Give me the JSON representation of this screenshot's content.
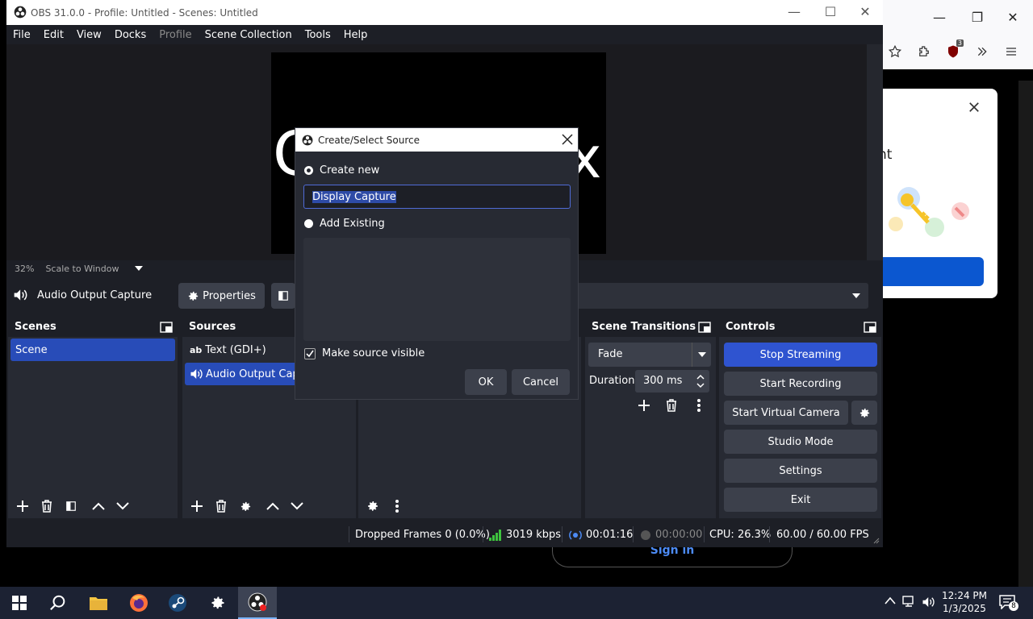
{
  "window": {
    "title": "OBS 31.0.0 - Profile: Untitled - Scenes: Untitled"
  },
  "menu": {
    "items": [
      "File",
      "Edit",
      "View",
      "Docks",
      "Profile",
      "Scene Collection",
      "Tools",
      "Help"
    ],
    "disabled": [
      "Profile"
    ]
  },
  "preview": {
    "overlay_text_left": "C",
    "overlay_text_right": "x",
    "zoom": "32%",
    "scale_mode": "Scale to Window"
  },
  "source_bar": {
    "source_name": "Audio Output Capture",
    "properties_label": "Properties"
  },
  "scenes": {
    "title": "Scenes",
    "items": [
      "Scene"
    ]
  },
  "sources": {
    "title": "Sources",
    "items": [
      {
        "label": "Text (GDI+)",
        "icon": "text-icon"
      },
      {
        "label": "Audio Output Capt",
        "icon": "speaker-icon"
      }
    ]
  },
  "transitions": {
    "title": "Scene Transitions",
    "type": "Fade",
    "duration_label": "Duration",
    "duration_value": "300 ms"
  },
  "controls": {
    "title": "Controls",
    "stop_streaming": "Stop Streaming",
    "start_recording": "Start Recording",
    "start_virtual_camera": "Start Virtual Camera",
    "studio_mode": "Studio Mode",
    "settings": "Settings",
    "exit": "Exit"
  },
  "status": {
    "dropped_frames": "Dropped Frames 0 (0.0%)",
    "bitrate": "3019 kbps",
    "stream_time": "00:01:16",
    "record_time": "00:00:00",
    "cpu": "CPU: 26.3%",
    "fps": "60.00 / 60.00 FPS"
  },
  "dialog": {
    "title": "Create/Select Source",
    "create_new_label": "Create new",
    "name_value": "Display Capture",
    "add_existing_label": "Add Existing",
    "make_visible_label": "Make source visible",
    "make_visible_checked": true,
    "ok_label": "OK",
    "cancel_label": "Cancel"
  },
  "browser": {
    "extension_badge": "3",
    "popup_partial_text": "nt",
    "signin_label": "Sign in"
  },
  "taskbar": {
    "time": "12:24 PM",
    "date": "1/3/2025",
    "notification_count": "8"
  },
  "colors": {
    "obs_bg": "#1d1f26",
    "dock_bg": "#272a33",
    "button": "#3c404b",
    "accent_blue": "#284cb8",
    "stop_streaming_blue": "#2f54d0"
  }
}
